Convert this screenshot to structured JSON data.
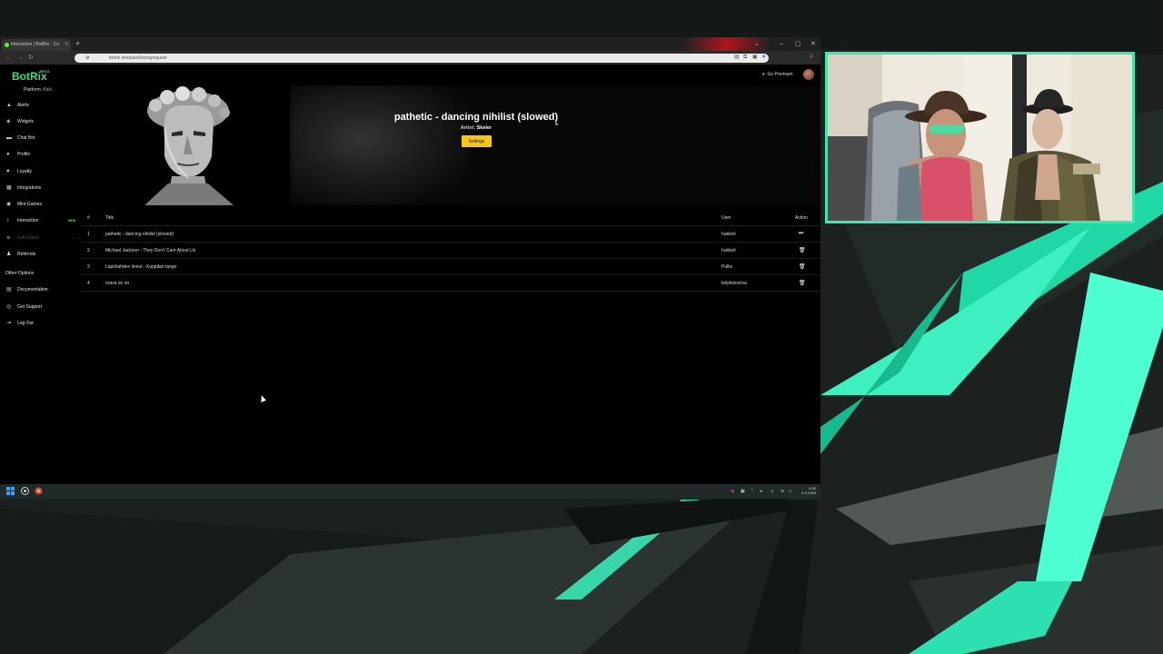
{
  "browser": {
    "tab_label": "Interaction | BotRix - Cu",
    "tab_close": "×",
    "new_tab": "+",
    "url": "botrix.live/panel/songrequest",
    "window_controls": [
      "⌄",
      "–",
      "▢",
      "✕"
    ]
  },
  "header": {
    "logo": "BotRix",
    "logo_badge": "BETA",
    "go_premium": "Go Premium"
  },
  "sidebar": {
    "platform_label": "Platform:",
    "platform_value": "Kick",
    "items": [
      {
        "label": "Alerts",
        "icon": "bell-icon"
      },
      {
        "label": "Widgets",
        "icon": "widget-icon"
      },
      {
        "label": "Chat Bot",
        "icon": "chat-icon"
      },
      {
        "label": "Profile",
        "icon": "user-icon"
      },
      {
        "label": "Loyalty",
        "icon": "trophy-icon"
      },
      {
        "label": "Integrations",
        "icon": "plug-icon"
      },
      {
        "label": "Mini-Games",
        "icon": "gamepad-icon"
      },
      {
        "label": "Interaction",
        "icon": "music-icon",
        "badge": "NEW"
      },
      {
        "label": "Sub-Users",
        "icon": "users-icon"
      },
      {
        "label": "Referrals",
        "icon": "people-icon"
      }
    ],
    "other_options": "Other Options",
    "other_items": [
      {
        "label": "Documentation",
        "icon": "doc-icon"
      },
      {
        "label": "Get Support",
        "icon": "support-icon"
      },
      {
        "label": "Log Out",
        "icon": "logout-icon"
      }
    ]
  },
  "now_playing": {
    "title": "pathetic - dancing nihilist (slowed)",
    "artist_label": "Artist:",
    "artist": "Skeler",
    "settings_button": "Settings"
  },
  "queue": {
    "headers": {
      "num": "#",
      "title": "Title",
      "user": "User",
      "action": "Action"
    },
    "rows": [
      {
        "num": "1",
        "title": "pathetic - dancing nihilist (slowed)",
        "user": "hukkeli",
        "action": "skip"
      },
      {
        "num": "2",
        "title": "Michael Jackson - They Don't Care About Us",
        "user": "hukkeli",
        "action": "delete"
      },
      {
        "num": "3",
        "title": "Lapinlahden linnut - Kuppilan tango",
        "user": "Pullis",
        "action": "delete"
      },
      {
        "num": "4",
        "title": "orava se on",
        "user": "keljoksnerva",
        "action": "delete"
      }
    ]
  },
  "taskbar": {
    "time": "4.50",
    "date": "6.3.2026"
  },
  "colors": {
    "accent": "#53fc18",
    "brand": "#3ddc84",
    "settings_button": "#f5c518",
    "cam_border": "#3ee7b0"
  }
}
